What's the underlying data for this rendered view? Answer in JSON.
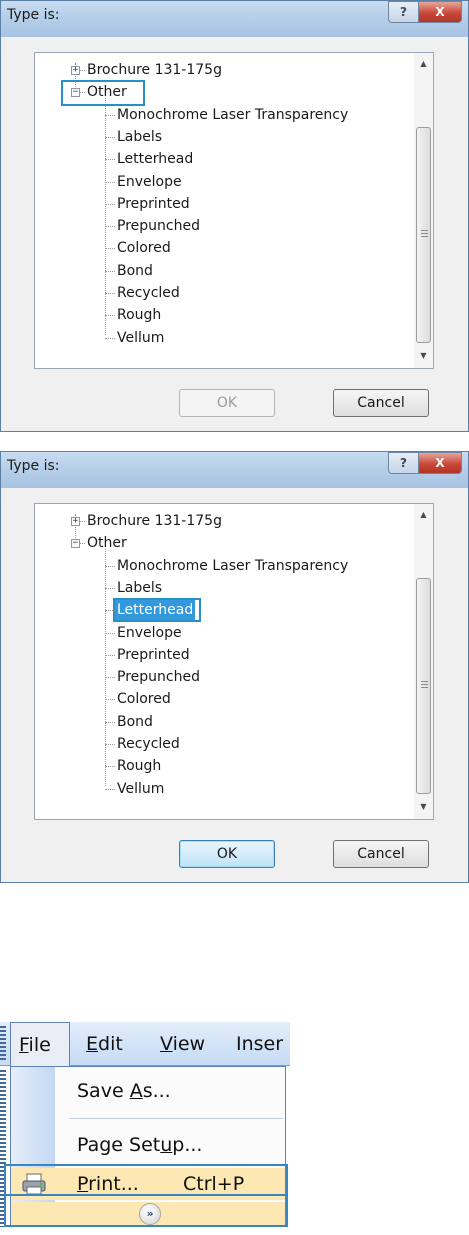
{
  "dialogs": [
    {
      "title": "Type is:",
      "help_glyph": "?",
      "close_glyph": "X",
      "tree": {
        "items": [
          {
            "label": "Brochure 131-175g",
            "expander": "+"
          },
          {
            "label": "Other",
            "expander": "−"
          },
          {
            "label": "Monochrome Laser Transparency"
          },
          {
            "label": "Labels"
          },
          {
            "label": "Letterhead"
          },
          {
            "label": "Envelope"
          },
          {
            "label": "Preprinted"
          },
          {
            "label": "Prepunched"
          },
          {
            "label": "Colored"
          },
          {
            "label": "Bond"
          },
          {
            "label": "Recycled"
          },
          {
            "label": "Rough"
          },
          {
            "label": "Vellum"
          }
        ],
        "highlighted_item": "Other",
        "selected_item": ""
      },
      "scroll": {
        "up": "▲",
        "down": "▼"
      },
      "ok_label": "OK",
      "ok_enabled": false,
      "cancel_label": "Cancel"
    },
    {
      "title": "Type is:",
      "help_glyph": "?",
      "close_glyph": "X",
      "tree": {
        "items": [
          {
            "label": "Brochure 131-175g",
            "expander": "+"
          },
          {
            "label": "Other",
            "expander": "−"
          },
          {
            "label": "Monochrome Laser Transparency"
          },
          {
            "label": "Labels"
          },
          {
            "label": "Letterhead"
          },
          {
            "label": "Envelope"
          },
          {
            "label": "Preprinted"
          },
          {
            "label": "Prepunched"
          },
          {
            "label": "Colored"
          },
          {
            "label": "Bond"
          },
          {
            "label": "Recycled"
          },
          {
            "label": "Rough"
          },
          {
            "label": "Vellum"
          }
        ],
        "highlighted_item": "",
        "selected_item": "Letterhead"
      },
      "scroll": {
        "up": "▲",
        "down": "▼"
      },
      "ok_label": "OK",
      "ok_enabled": true,
      "cancel_label": "Cancel"
    }
  ],
  "office_menu": {
    "menubar": [
      {
        "label": "File",
        "underline": "F",
        "rest": "ile",
        "open": true
      },
      {
        "label": "Edit",
        "underline": "E",
        "rest": "dit"
      },
      {
        "label": "View",
        "underline": "V",
        "rest": "iew"
      },
      {
        "label": "Inser",
        "underline": "",
        "rest": "Inser"
      }
    ],
    "items": {
      "save_as": {
        "pre": "Save ",
        "u": "A",
        "post": "s..."
      },
      "page_setup": {
        "pre": "Page Set",
        "u": "u",
        "post": "p..."
      },
      "print": {
        "pre": "",
        "u": "P",
        "post": "rint...",
        "shortcut": "Ctrl+P"
      },
      "expand_glyph": "»"
    },
    "colors": {
      "highlight": "#fde7b3",
      "frame": "#3a86c2"
    }
  }
}
